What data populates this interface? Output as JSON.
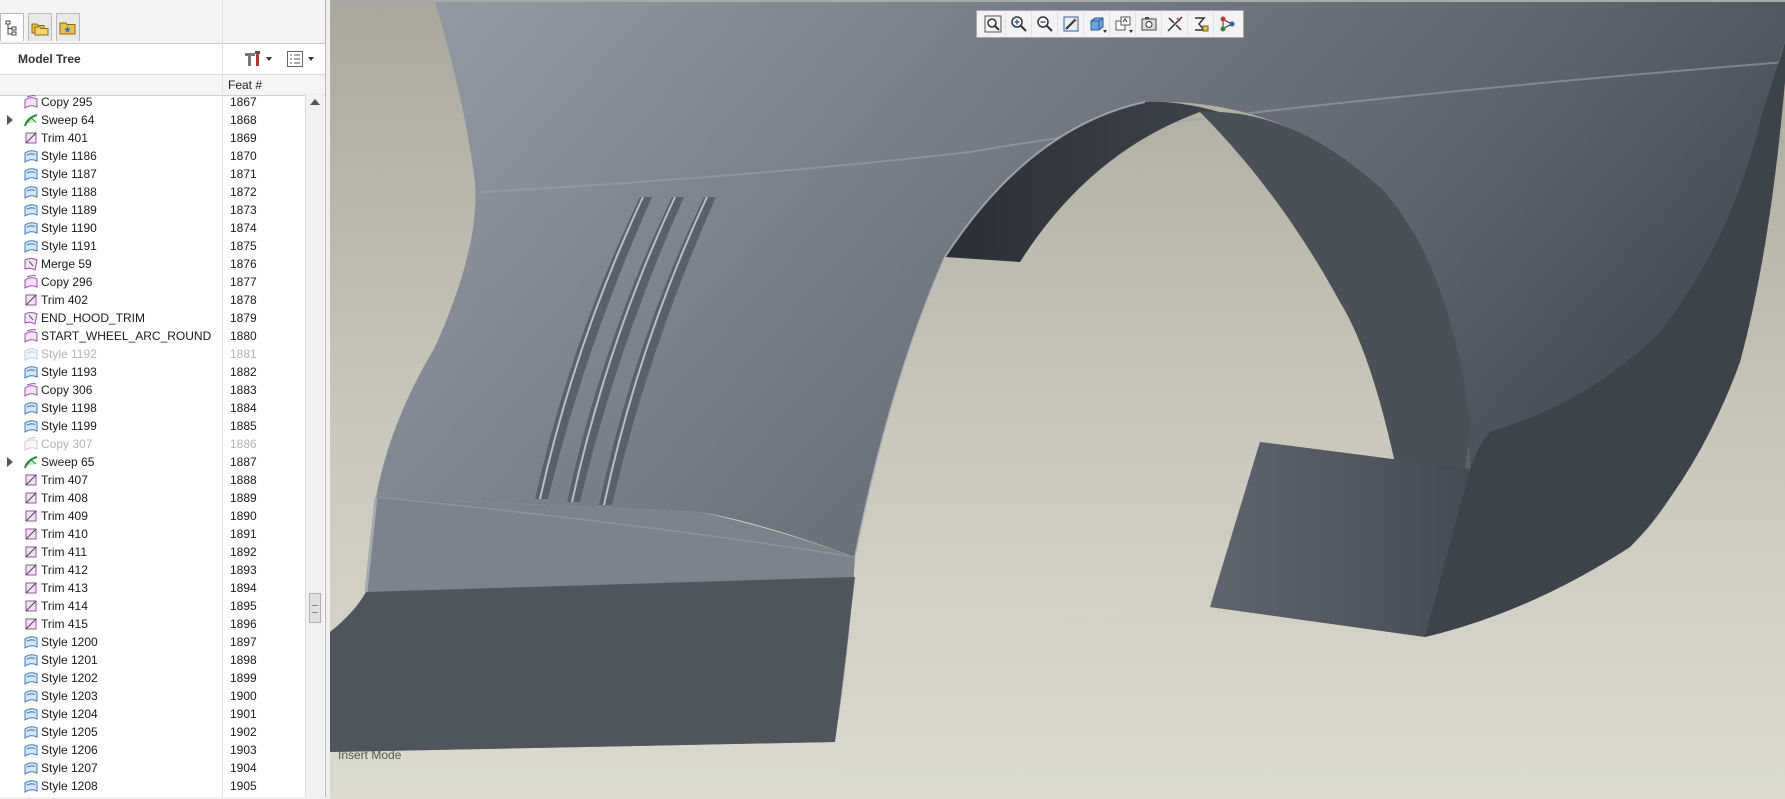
{
  "panel_tabs": [
    {
      "name": "model-tree",
      "icon": "model-tree-icon"
    },
    {
      "name": "folder-browser",
      "icon": "folder-browser-icon"
    },
    {
      "name": "favorites",
      "icon": "favorites-icon"
    }
  ],
  "model_tree": {
    "title": "Model Tree",
    "column_header": "Feat #",
    "settings_icon": "tree-settings-icon",
    "filter_icon": "tree-filter-icon",
    "rows": [
      {
        "name": "Copy 295",
        "num": "1867",
        "type": "copy",
        "expandable": false,
        "suppressed": false
      },
      {
        "name": "Sweep 64",
        "num": "1868",
        "type": "sweep",
        "expandable": true,
        "suppressed": false
      },
      {
        "name": "Trim 401",
        "num": "1869",
        "type": "trim",
        "expandable": false,
        "suppressed": false
      },
      {
        "name": "Style 1186",
        "num": "1870",
        "type": "style",
        "expandable": false,
        "suppressed": false
      },
      {
        "name": "Style 1187",
        "num": "1871",
        "type": "style",
        "expandable": false,
        "suppressed": false
      },
      {
        "name": "Style 1188",
        "num": "1872",
        "type": "style",
        "expandable": false,
        "suppressed": false
      },
      {
        "name": "Style 1189",
        "num": "1873",
        "type": "style",
        "expandable": false,
        "suppressed": false
      },
      {
        "name": "Style 1190",
        "num": "1874",
        "type": "style",
        "expandable": false,
        "suppressed": false
      },
      {
        "name": "Style 1191",
        "num": "1875",
        "type": "style",
        "expandable": false,
        "suppressed": false
      },
      {
        "name": "Merge 59",
        "num": "1876",
        "type": "merge",
        "expandable": false,
        "suppressed": false
      },
      {
        "name": "Copy 296",
        "num": "1877",
        "type": "copy",
        "expandable": false,
        "suppressed": false
      },
      {
        "name": "Trim 402",
        "num": "1878",
        "type": "trim",
        "expandable": false,
        "suppressed": false
      },
      {
        "name": "END_HOOD_TRIM",
        "num": "1879",
        "type": "merge",
        "expandable": false,
        "suppressed": false
      },
      {
        "name": "START_WHEEL_ARC_ROUND",
        "num": "1880",
        "type": "copy",
        "expandable": false,
        "suppressed": false
      },
      {
        "name": "Style 1192",
        "num": "1881",
        "type": "style",
        "expandable": false,
        "suppressed": true
      },
      {
        "name": "Style 1193",
        "num": "1882",
        "type": "style",
        "expandable": false,
        "suppressed": false
      },
      {
        "name": "Copy 306",
        "num": "1883",
        "type": "copy",
        "expandable": false,
        "suppressed": false
      },
      {
        "name": "Style 1198",
        "num": "1884",
        "type": "style",
        "expandable": false,
        "suppressed": false
      },
      {
        "name": "Style 1199",
        "num": "1885",
        "type": "style",
        "expandable": false,
        "suppressed": false
      },
      {
        "name": "Copy 307",
        "num": "1886",
        "type": "copy",
        "expandable": false,
        "suppressed": true
      },
      {
        "name": "Sweep 65",
        "num": "1887",
        "type": "sweep",
        "expandable": true,
        "suppressed": false
      },
      {
        "name": "Trim 407",
        "num": "1888",
        "type": "trim",
        "expandable": false,
        "suppressed": false
      },
      {
        "name": "Trim 408",
        "num": "1889",
        "type": "trim",
        "expandable": false,
        "suppressed": false
      },
      {
        "name": "Trim 409",
        "num": "1890",
        "type": "trim",
        "expandable": false,
        "suppressed": false
      },
      {
        "name": "Trim 410",
        "num": "1891",
        "type": "trim",
        "expandable": false,
        "suppressed": false
      },
      {
        "name": "Trim 411",
        "num": "1892",
        "type": "trim",
        "expandable": false,
        "suppressed": false
      },
      {
        "name": "Trim 412",
        "num": "1893",
        "type": "trim",
        "expandable": false,
        "suppressed": false
      },
      {
        "name": "Trim 413",
        "num": "1894",
        "type": "trim",
        "expandable": false,
        "suppressed": false
      },
      {
        "name": "Trim 414",
        "num": "1895",
        "type": "trim",
        "expandable": false,
        "suppressed": false
      },
      {
        "name": "Trim 415",
        "num": "1896",
        "type": "trim",
        "expandable": false,
        "suppressed": false
      },
      {
        "name": "Style 1200",
        "num": "1897",
        "type": "style",
        "expandable": false,
        "suppressed": false
      },
      {
        "name": "Style 1201",
        "num": "1898",
        "type": "style",
        "expandable": false,
        "suppressed": false
      },
      {
        "name": "Style 1202",
        "num": "1899",
        "type": "style",
        "expandable": false,
        "suppressed": false
      },
      {
        "name": "Style 1203",
        "num": "1900",
        "type": "style",
        "expandable": false,
        "suppressed": false
      },
      {
        "name": "Style 1204",
        "num": "1901",
        "type": "style",
        "expandable": false,
        "suppressed": false
      },
      {
        "name": "Style 1205",
        "num": "1902",
        "type": "style",
        "expandable": false,
        "suppressed": false
      },
      {
        "name": "Style 1206",
        "num": "1903",
        "type": "style",
        "expandable": false,
        "suppressed": false
      },
      {
        "name": "Style 1207",
        "num": "1904",
        "type": "style",
        "expandable": false,
        "suppressed": false
      },
      {
        "name": "Style 1208",
        "num": "1905",
        "type": "style",
        "expandable": false,
        "suppressed": false
      }
    ]
  },
  "view_toolbar": {
    "buttons": [
      {
        "name": "refit",
        "icon": "refit-icon"
      },
      {
        "name": "zoom-in",
        "icon": "zoom-in-icon"
      },
      {
        "name": "zoom-out",
        "icon": "zoom-out-icon"
      },
      {
        "name": "repaint",
        "icon": "repaint-icon"
      },
      {
        "name": "display-style",
        "icon": "display-style-icon"
      },
      {
        "name": "saved-views",
        "icon": "saved-views-icon"
      },
      {
        "name": "view-manager",
        "icon": "view-manager-icon"
      },
      {
        "name": "datum-display",
        "icon": "datum-display-icon"
      },
      {
        "name": "annotation-display",
        "icon": "annotation-display-icon"
      },
      {
        "name": "spin-center",
        "icon": "spin-center-icon"
      }
    ]
  },
  "viewport": {
    "mode_text": "Insert Mode",
    "background_color": "#d6d4c7",
    "model_color": "#6f7680"
  },
  "colors": {
    "style_icon": "#3c7ab8",
    "copy_icon": "#9a4fa8",
    "trim_icon": "#9a4fa8",
    "sweep_icon": "#2e8a3a",
    "suppressed_text": "#b4b4b4"
  }
}
